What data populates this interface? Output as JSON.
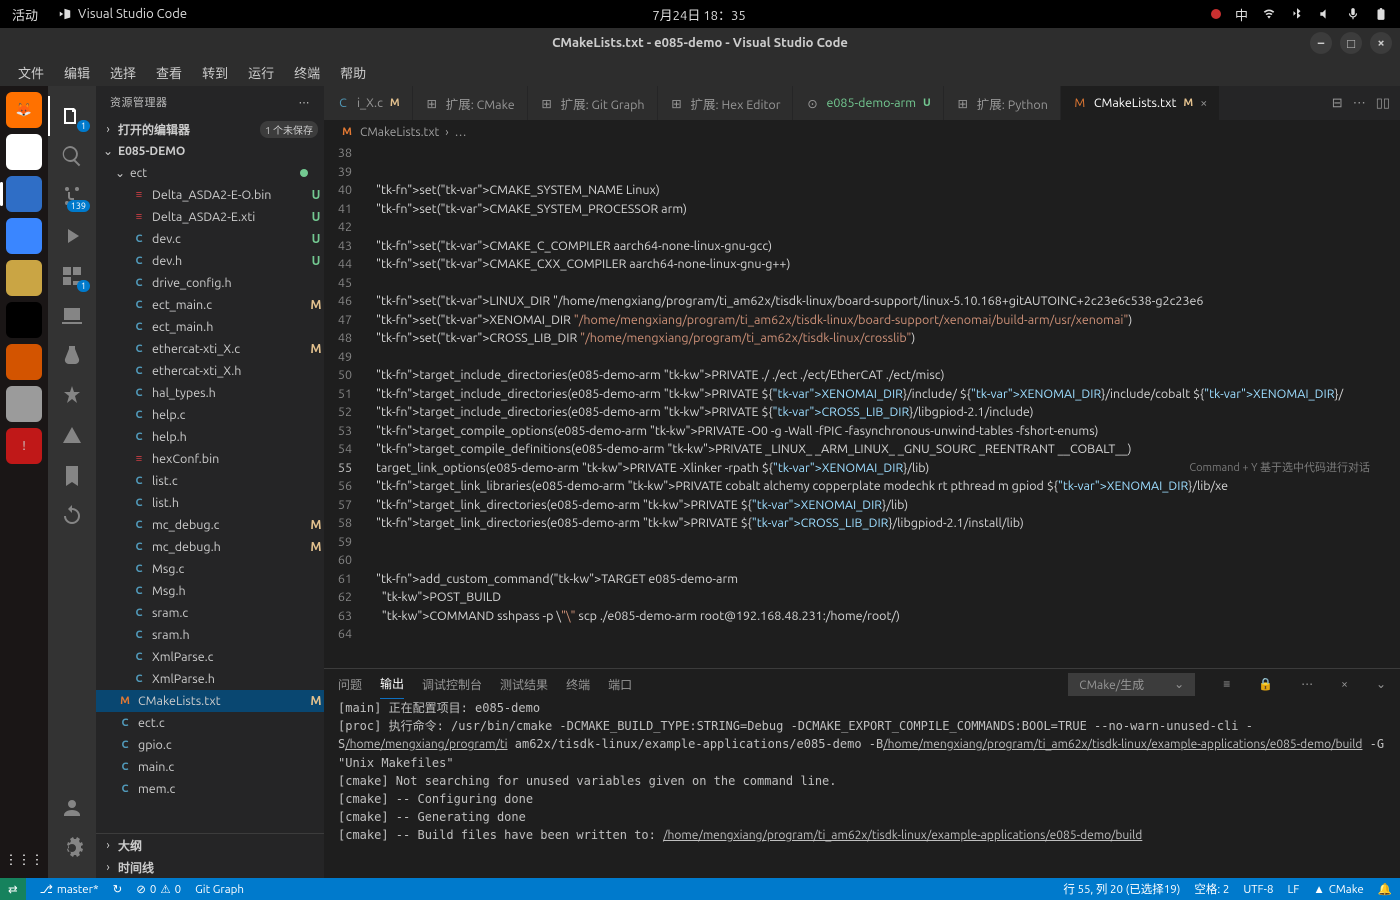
{
  "system": {
    "activities": "活动",
    "app_name": "Visual Studio Code",
    "clock": "7月24日  18：35",
    "lang": "中"
  },
  "window": {
    "title": "CMakeLists.txt - e085-demo - Visual Studio Code"
  },
  "menu": [
    "文件",
    "编辑",
    "选择",
    "查看",
    "转到",
    "运行",
    "终端",
    "帮助"
  ],
  "sidebar": {
    "title": "资源管理器",
    "open_editors": "打开的编辑器",
    "unsaved_badge": "1 个未保存",
    "project": "E085-DEMO",
    "ect_folder": "ect",
    "outline": "大纲",
    "timeline": "时间线",
    "files": [
      {
        "icon": "bin",
        "name": "Delta_ASDA2-E-O.bin",
        "status": "U",
        "nested": true
      },
      {
        "icon": "bin",
        "name": "Delta_ASDA2-E.xti",
        "status": "U",
        "nested": true
      },
      {
        "icon": "C",
        "name": "dev.c",
        "status": "U"
      },
      {
        "icon": "C",
        "name": "dev.h",
        "status": "U"
      },
      {
        "icon": "C",
        "name": "drive_config.h",
        "status": ""
      },
      {
        "icon": "C",
        "name": "ect_main.c",
        "status": "M"
      },
      {
        "icon": "C",
        "name": "ect_main.h",
        "status": ""
      },
      {
        "icon": "C",
        "name": "ethercat-xti_X.c",
        "status": "M"
      },
      {
        "icon": "C",
        "name": "ethercat-xti_X.h",
        "status": ""
      },
      {
        "icon": "C",
        "name": "hal_types.h",
        "status": ""
      },
      {
        "icon": "C",
        "name": "help.c",
        "status": ""
      },
      {
        "icon": "C",
        "name": "help.h",
        "status": ""
      },
      {
        "icon": "bin",
        "name": "hexConf.bin",
        "status": ""
      },
      {
        "icon": "C",
        "name": "list.c",
        "status": ""
      },
      {
        "icon": "C",
        "name": "list.h",
        "status": ""
      },
      {
        "icon": "C",
        "name": "mc_debug.c",
        "status": "M"
      },
      {
        "icon": "C",
        "name": "mc_debug.h",
        "status": "M"
      },
      {
        "icon": "C",
        "name": "Msg.c",
        "status": ""
      },
      {
        "icon": "C",
        "name": "Msg.h",
        "status": ""
      },
      {
        "icon": "C",
        "name": "sram.c",
        "status": ""
      },
      {
        "icon": "C",
        "name": "sram.h",
        "status": ""
      },
      {
        "icon": "C",
        "name": "XmlParse.c",
        "status": ""
      },
      {
        "icon": "C",
        "name": "XmlParse.h",
        "status": ""
      },
      {
        "icon": "M",
        "name": "CMakeLists.txt",
        "status": "M",
        "selected": true,
        "depth": 0
      },
      {
        "icon": "C",
        "name": "ect.c",
        "status": "",
        "depth": 0
      },
      {
        "icon": "C",
        "name": "gpio.c",
        "status": "",
        "depth": 0
      },
      {
        "icon": "C",
        "name": "main.c",
        "status": "",
        "depth": 0
      },
      {
        "icon": "C",
        "name": "mem.c",
        "status": "",
        "depth": 0
      }
    ]
  },
  "activity_badges": {
    "explorer": "1",
    "scm": "139",
    "ext": "1"
  },
  "tabs": [
    {
      "label": "i_X.c",
      "status": "M",
      "icon": "C"
    },
    {
      "label": "扩展: CMake",
      "icon": "ext"
    },
    {
      "label": "扩展: Git Graph",
      "icon": "ext"
    },
    {
      "label": "扩展: Hex Editor",
      "icon": "ext"
    },
    {
      "label": "e085-demo-arm",
      "status": "U",
      "icon": "run",
      "color": "#73c991"
    },
    {
      "label": "扩展: Python",
      "icon": "ext"
    },
    {
      "label": "CMakeLists.txt",
      "status": "M",
      "icon": "M",
      "active": true,
      "close": true
    }
  ],
  "breadcrumb": {
    "file": "CMakeLists.txt",
    "more": "…"
  },
  "code": {
    "start": 38,
    "lines": [
      "",
      "",
      "set(CMAKE_SYSTEM_NAME Linux)",
      "set(CMAKE_SYSTEM_PROCESSOR arm)",
      "",
      "set(CMAKE_C_COMPILER aarch64-none-linux-gnu-gcc)",
      "set(CMAKE_CXX_COMPILER aarch64-none-linux-gnu-g++)",
      "",
      "set(LINUX_DIR \"/home/mengxiang/program/ti_am62x/tisdk-linux/board-support/linux-5.10.168+gitAUTOINC+2c23e6c538-g2c23e6",
      "set(XENOMAI_DIR \"/home/mengxiang/program/ti_am62x/tisdk-linux/board-support/xenomai/build-arm/usr/xenomai\")",
      "set(CROSS_LIB_DIR \"/home/mengxiang/program/ti_am62x/tisdk-linux/crosslib\")",
      "",
      "target_include_directories(e085-demo-arm PRIVATE ./ ./ect ./ect/EtherCAT ./ect/misc)",
      "target_include_directories(e085-demo-arm PRIVATE ${XENOMAI_DIR}/include/ ${XENOMAI_DIR}/include/cobalt ${XENOMAI_DIR}/",
      "target_include_directories(e085-demo-arm PRIVATE ${CROSS_LIB_DIR}/libgpiod-2.1/include)",
      "target_compile_options(e085-demo-arm PRIVATE -O0 -g -Wall -fPIC -fasynchronous-unwind-tables -fshort-enums)",
      "target_compile_definitions(e085-demo-arm PRIVATE _LINUX_ _ARM_LINUX_ _GNU_SOURC _REENTRANT __COBALT__)",
      "target_link_options(e085-demo-arm PRIVATE -Xlinker -rpath ${XENOMAI_DIR}/lib)",
      "target_link_libraries(e085-demo-arm PRIVATE cobalt alchemy copperplate modechk rt pthread m gpiod ${XENOMAI_DIR}/lib/xe",
      "target_link_directories(e085-demo-arm PRIVATE ${XENOMAI_DIR}/lib)",
      "target_link_directories(e085-demo-arm PRIVATE ${CROSS_LIB_DIR}/libgpiod-2.1/install/lib)",
      "",
      "",
      "add_custom_command(TARGET e085-demo-arm",
      "  POST_BUILD",
      "  COMMAND sshpass -p \\\"\\\" scp ./e085-demo-arm root@192.168.48.231:/home/root/)",
      ""
    ],
    "highlight_line": 55,
    "highlight_text": "target_link_options",
    "hint": "Command + Y 基于选中代码进行对话"
  },
  "panel": {
    "tabs": [
      "问题",
      "输出",
      "调试控制台",
      "测试结果",
      "终端",
      "端口"
    ],
    "active": 1,
    "selector": "CMake/生成",
    "output": [
      "[main] 正在配置项目: e085-demo",
      "[proc] 执行命令: /usr/bin/cmake -DCMAKE_BUILD_TYPE:STRING=Debug -DCMAKE_EXPORT_COMPILE_COMMANDS:BOOL=TRUE --no-warn-unused-cli -S/home/mengxiang/program/ti am62x/tisdk-linux/example-applications/e085-demo -B/home/mengxiang/program/ti_am62x/tisdk-linux/example-applications/e085-demo/build -G \"Unix Makefiles\"",
      "[cmake] Not searching for unused variables given on the command line.",
      "[cmake] -- Configuring done",
      "[cmake] -- Generating done",
      "[cmake] -- Build files have been written to: /home/mengxiang/program/ti_am62x/tisdk-linux/example-applications/e085-demo/build"
    ]
  },
  "status": {
    "branch": "master*",
    "sync": "↻",
    "errors": "0",
    "warnings": "0",
    "graph": "Git Graph",
    "cursor": "行 55, 列 20 (已选择19)",
    "spaces": "空格: 2",
    "encoding": "UTF-8",
    "eol": "LF",
    "lang": "CMake",
    "bell": "🔔"
  }
}
